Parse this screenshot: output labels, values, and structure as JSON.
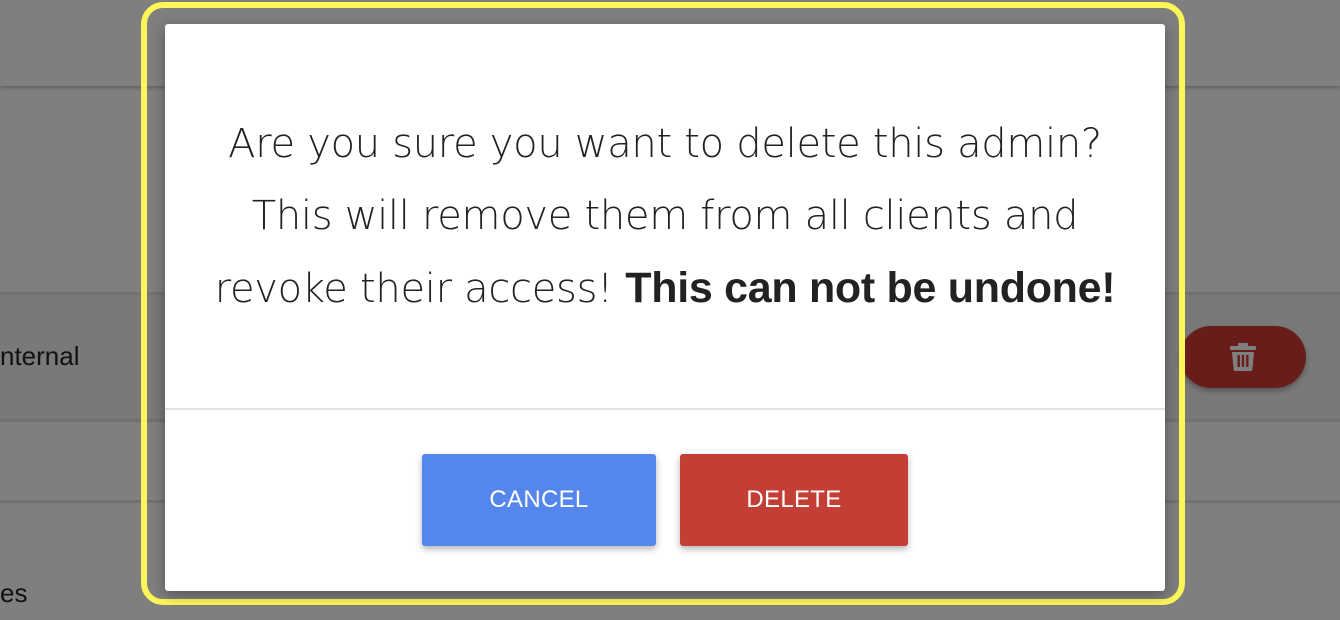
{
  "background": {
    "row_label_internal": "nternal",
    "row_label_es": "es",
    "trash_button_color": "#d23b34"
  },
  "modal": {
    "message_text": "Are you sure you want to delete this admin? This will remove them from all clients and revoke their access! ",
    "message_emphasis": "This can not be undone!",
    "cancel_label": "CANCEL",
    "delete_label": "DELETE",
    "cancel_color": "#5586eb",
    "delete_color": "#c33e34",
    "highlight_color": "#fdf659"
  },
  "icons": {
    "trash": "trash-icon"
  }
}
